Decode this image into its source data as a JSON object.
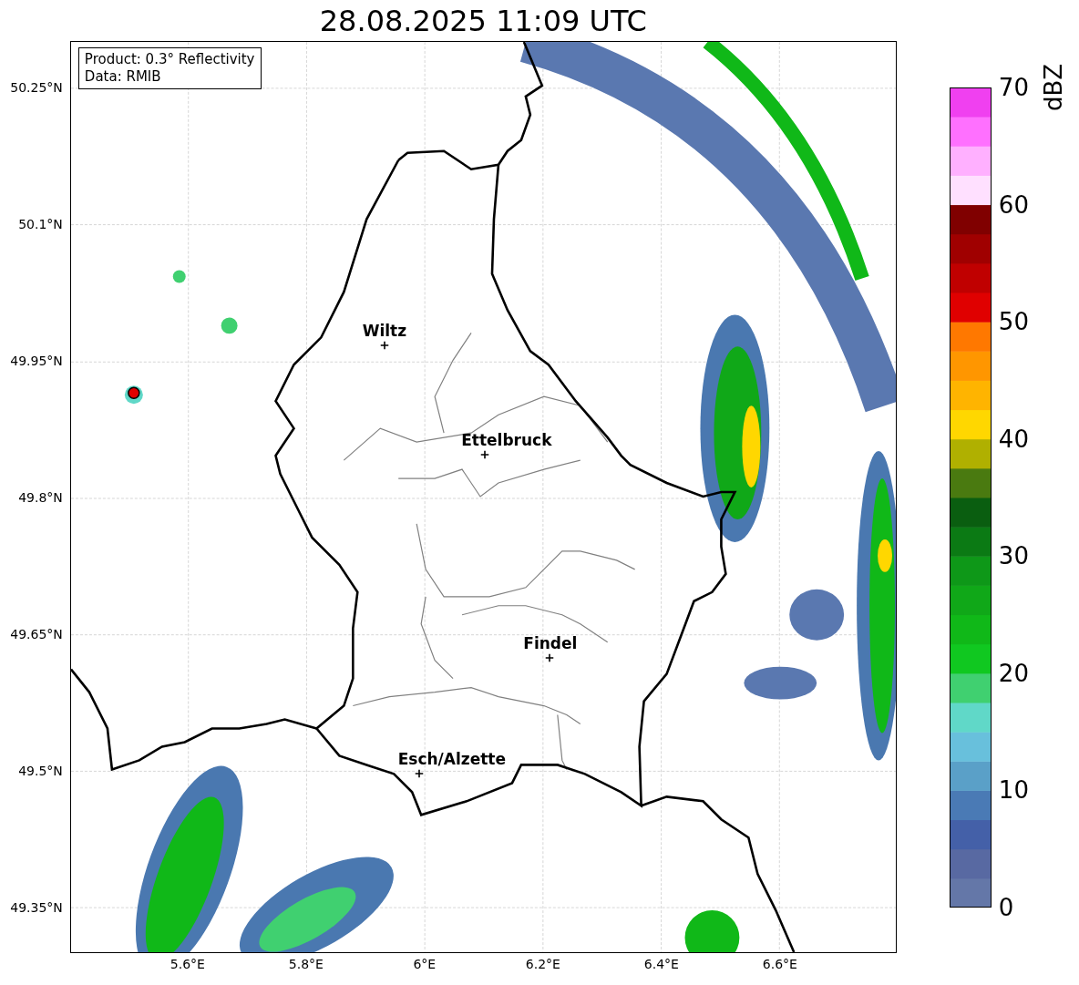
{
  "title": "28.08.2025 11:09 UTC",
  "info_box": {
    "lines": [
      "Product: 0.3° Reflectivity",
      "Data: RMIB"
    ]
  },
  "map": {
    "cities": [
      {
        "name": "Wiltz"
      },
      {
        "name": "Ettelbruck"
      },
      {
        "name": "Findel"
      },
      {
        "name": "Esch/Alzette"
      }
    ]
  },
  "y_ticks": [
    "50.25°N",
    "50.1°N",
    "49.95°N",
    "49.8°N",
    "49.65°N",
    "49.5°N",
    "49.35°N"
  ],
  "x_ticks": [
    "5.6°E",
    "5.8°E",
    "6°E",
    "6.2°E",
    "6.4°E",
    "6.6°E"
  ],
  "colorbar": {
    "label": "dBZ",
    "ticks": [
      "70",
      "60",
      "50",
      "40",
      "30",
      "20",
      "10",
      "0"
    ]
  }
}
